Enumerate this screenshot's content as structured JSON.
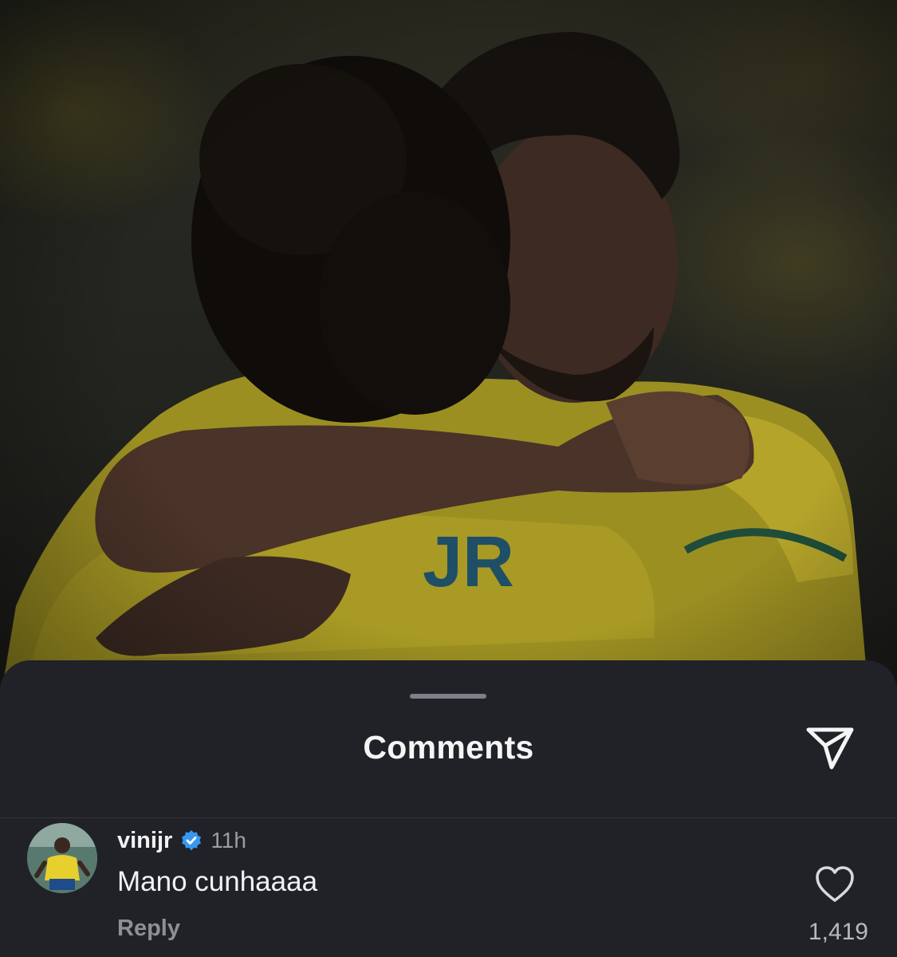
{
  "post": {
    "image_label": "Two players in yellow jerseys embracing",
    "jersey_text": "JR"
  },
  "comments_sheet": {
    "title": "Comments",
    "share_icon": "send-icon"
  },
  "comments": [
    {
      "username": "vinijr",
      "verified": true,
      "time": "11h",
      "text": "Mano cunhaaaa",
      "reply_label": "Reply",
      "like_count": "1,419",
      "like_icon": "heart-outline-icon"
    }
  ],
  "colors": {
    "sheet_background": "#202227",
    "verified_blue": "#3897f0",
    "primary_text": "#f2f2f2",
    "secondary_text": "#9b9da3"
  }
}
